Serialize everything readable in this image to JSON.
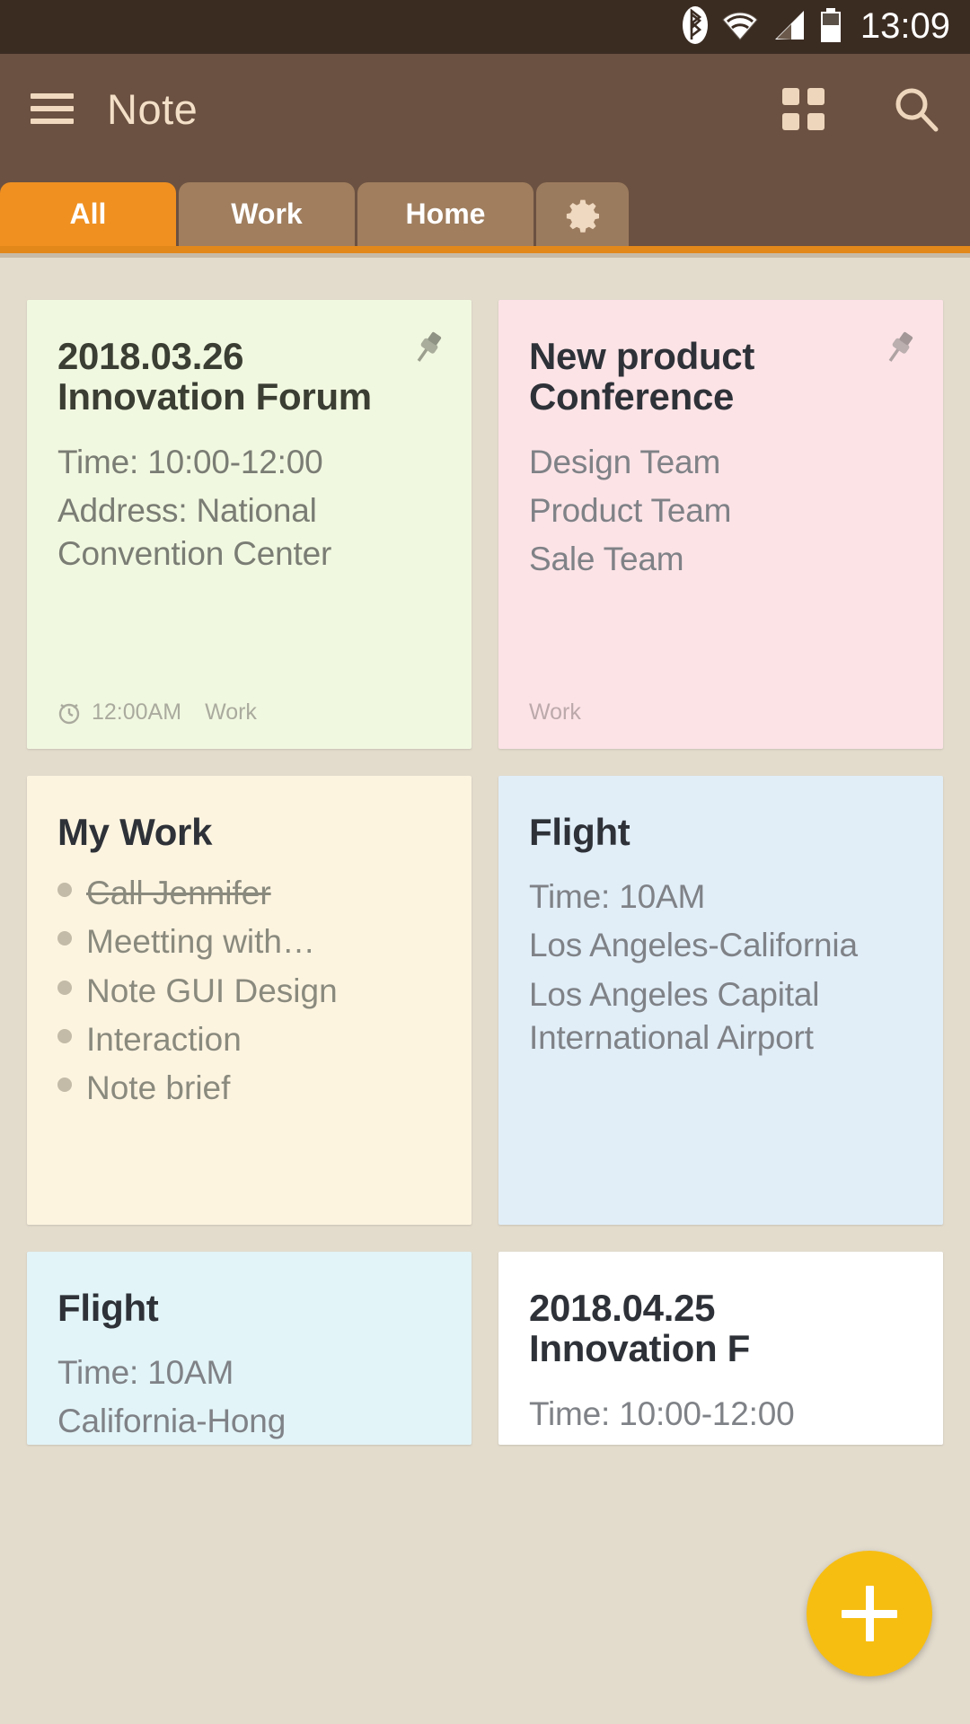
{
  "statusbar": {
    "time": "13:09",
    "icons": [
      "bluetooth-icon",
      "wifi-icon",
      "signal-icon",
      "battery-icon"
    ]
  },
  "appbar": {
    "title": "Note",
    "menu_icon": "hamburger-icon",
    "grid_icon": "grid-view-icon",
    "search_icon": "search-icon"
  },
  "tabs": [
    {
      "label": "All",
      "active": true
    },
    {
      "label": "Work",
      "active": false
    },
    {
      "label": "Home",
      "active": false
    },
    {
      "label": "",
      "icon": "gear-icon",
      "active": false
    }
  ],
  "colors": {
    "accent": "#EF9021",
    "appbar": "#6B5141",
    "statusbar": "#3B2C22",
    "page_bg": "#E3DCCD",
    "fab": "#F7BE12"
  },
  "notes": [
    {
      "title": "2018.03.26 Innovation Forum",
      "lines": [
        "Time: 10:00-12:00",
        "Address: National Convention Center"
      ],
      "pinned": true,
      "reminder": "12:00AM",
      "tag": "Work"
    },
    {
      "title": "New product Conference",
      "lines": [
        "Design Team",
        "Product Team",
        "Sale Team"
      ],
      "pinned": true,
      "reminder": "",
      "tag": "Work"
    },
    {
      "title": "My Work",
      "bullets": [
        {
          "text": "Call Jennifer",
          "done": true
        },
        {
          "text": "Meetting with…",
          "done": false
        },
        {
          "text": "Note GUI Design",
          "done": false
        },
        {
          "text": "Interaction",
          "done": false
        },
        {
          "text": "Note brief",
          "done": false
        }
      ],
      "pinned": false,
      "reminder": "",
      "tag": ""
    },
    {
      "title": "Flight",
      "lines": [
        "Time: 10AM",
        "Los Angeles-California",
        "Los Angeles Capital International Airport"
      ],
      "pinned": false,
      "reminder": "",
      "tag": ""
    },
    {
      "title": "Flight",
      "lines": [
        "Time: 10AM",
        "California-Hong"
      ],
      "pinned": false,
      "reminder": "",
      "tag": ""
    },
    {
      "title": "2018.04.25 Innovation F",
      "lines": [
        "Time: 10:00-12:00"
      ],
      "pinned": false,
      "reminder": "",
      "tag": ""
    }
  ],
  "fab": {
    "label": "+",
    "name": "add-note-button"
  }
}
